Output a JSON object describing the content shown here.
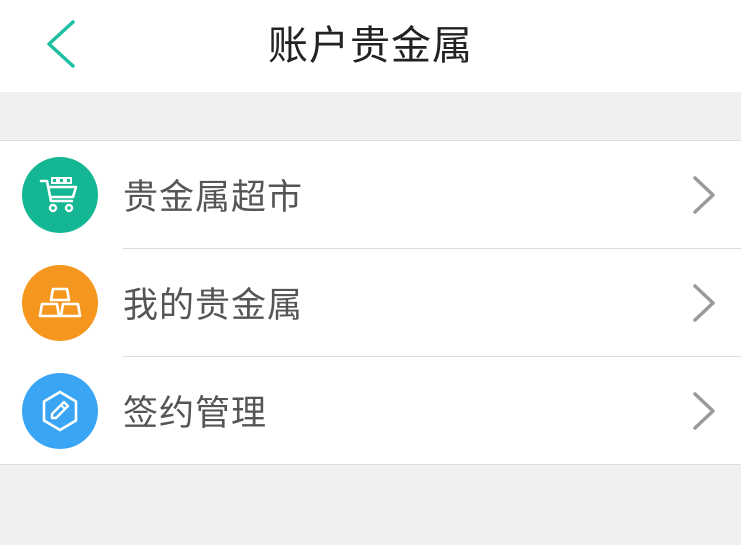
{
  "header": {
    "title": "账户贵金属",
    "back_icon": "chevron-left-icon",
    "accent_color": "#1dbfa0"
  },
  "menu": {
    "items": [
      {
        "label": "贵金属超市",
        "icon": "shopping-cart-icon",
        "icon_bg": "#14b693"
      },
      {
        "label": "我的贵金属",
        "icon": "gold-bars-icon",
        "icon_bg": "#f5971e"
      },
      {
        "label": "签约管理",
        "icon": "pencil-icon",
        "icon_bg": "#3aa5f5"
      }
    ],
    "chevron_icon": "chevron-right-icon"
  }
}
